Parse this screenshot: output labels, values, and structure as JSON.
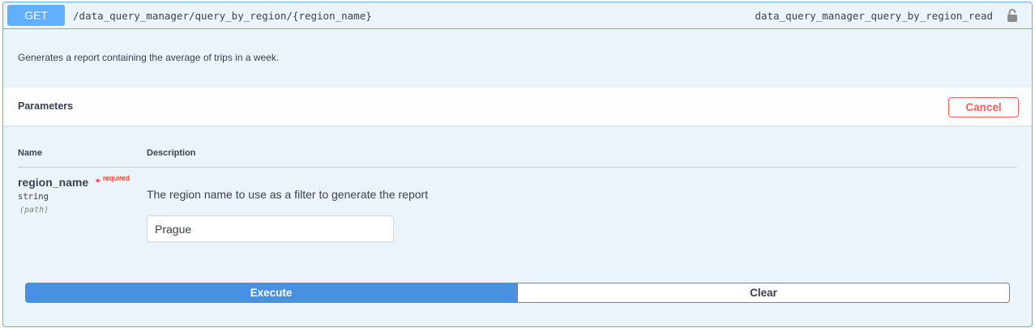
{
  "operation": {
    "method": "GET",
    "path": "/data_query_manager/query_by_region/{region_name}",
    "operation_id": "data_query_manager_query_by_region_read",
    "lock_icon": "lock-icon",
    "description": "Generates a report containing the average of trips in a week."
  },
  "parameters": {
    "title": "Parameters",
    "cancel_label": "Cancel",
    "columns": {
      "name": "Name",
      "description": "Description"
    },
    "items": [
      {
        "name": "region_name",
        "required_star": "*",
        "required_text": "required",
        "type": "string",
        "in": "(path)",
        "description": "The region name to use as a filter to generate the report",
        "value": "Prague"
      }
    ]
  },
  "actions": {
    "execute_label": "Execute",
    "clear_label": "Clear"
  },
  "colors": {
    "get_method": "#61affe",
    "execute": "#4990e2",
    "cancel": "#ff6060",
    "required": "#ff0000"
  }
}
